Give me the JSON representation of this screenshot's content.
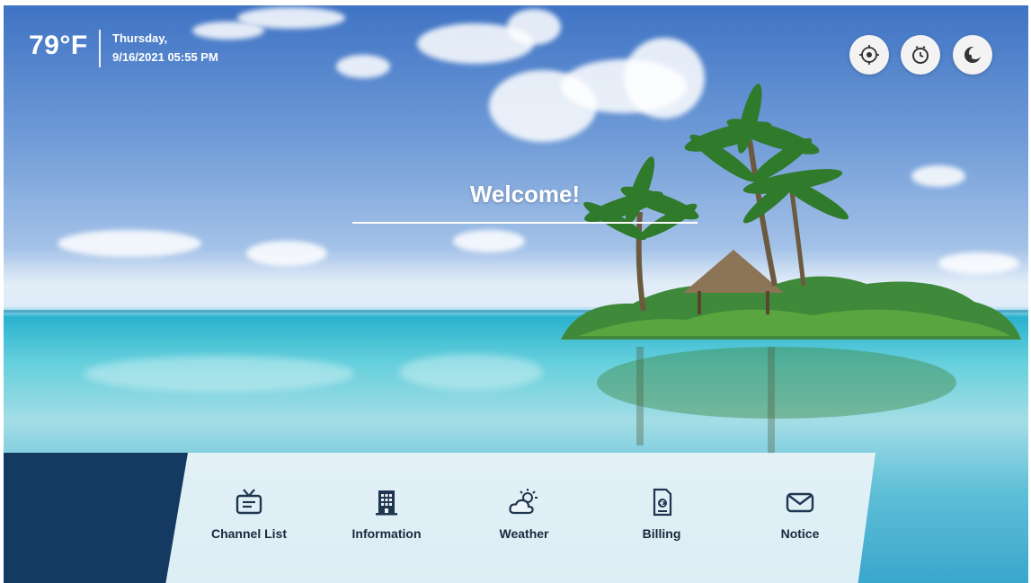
{
  "status": {
    "temperature": "79°F",
    "day": "Thursday,",
    "datetime": "9/16/2021 05:55 PM"
  },
  "top_buttons": [
    {
      "icon": "target-icon"
    },
    {
      "icon": "clock-icon"
    },
    {
      "icon": "moon-icon"
    }
  ],
  "welcome": "Welcome!",
  "menu": [
    {
      "label": "Channel List",
      "icon": "tv-icon"
    },
    {
      "label": "Information",
      "icon": "building-icon"
    },
    {
      "label": "Weather",
      "icon": "cloud-sun-icon"
    },
    {
      "label": "Billing",
      "icon": "document-euro-icon"
    },
    {
      "label": "Notice",
      "icon": "envelope-icon"
    }
  ],
  "colors": {
    "menu_panel": "#153a61",
    "menu_label": "#1a2a3e",
    "icon_stroke": "#1f3550"
  }
}
